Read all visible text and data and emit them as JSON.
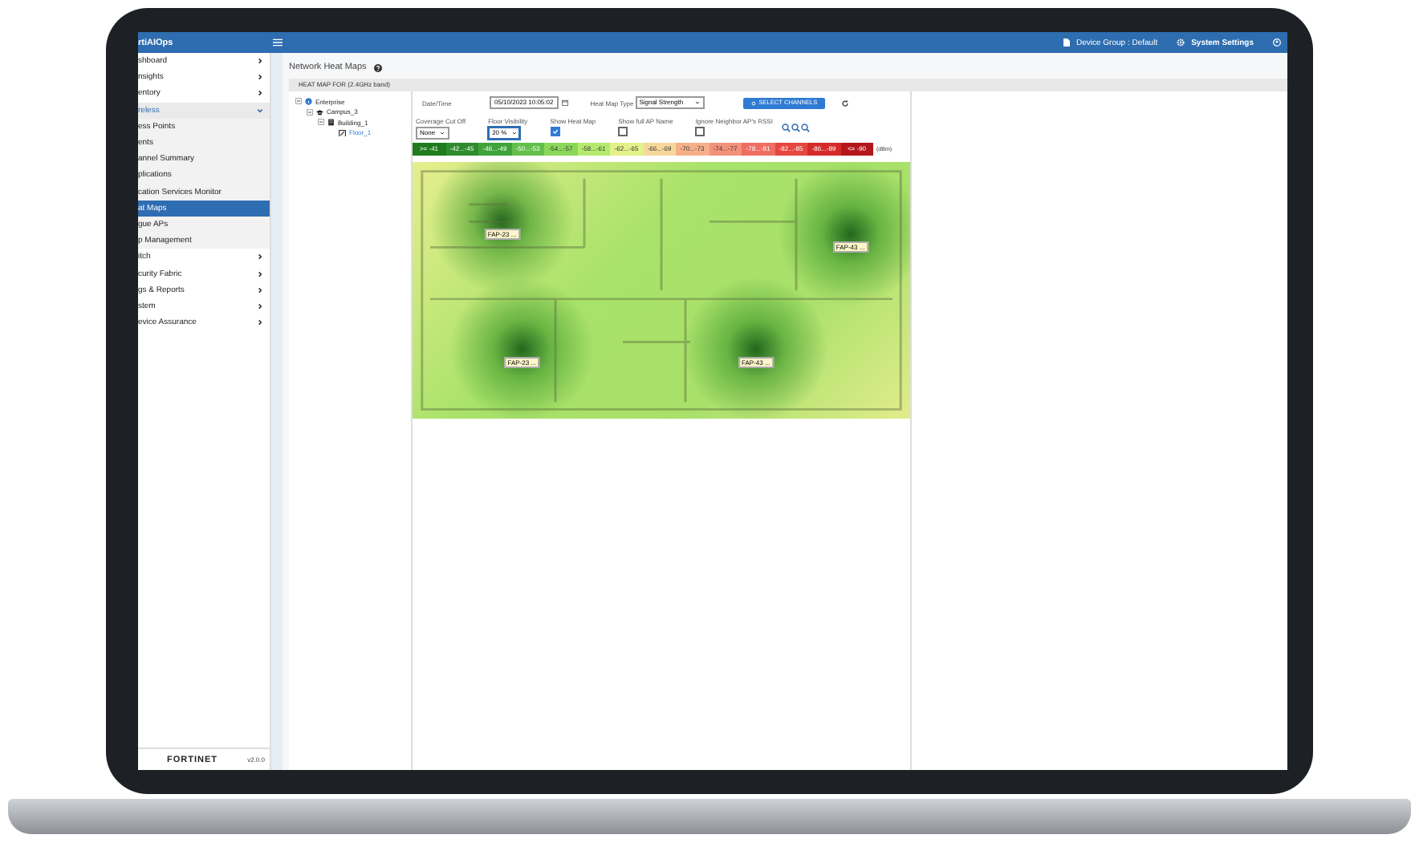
{
  "app": {
    "brand": "rtiAIOps"
  },
  "header": {
    "device_group": "Device Group : Default",
    "settings": "System Settings"
  },
  "sidebar": {
    "items": [
      {
        "label": "shboard",
        "kind": "group",
        "expanded": false,
        "selected": false
      },
      {
        "label": "nsights",
        "kind": "group",
        "expanded": false,
        "selected": false
      },
      {
        "label": "entory",
        "kind": "group",
        "expanded": false,
        "selected": false
      },
      {
        "label": "reless",
        "kind": "group",
        "expanded": true,
        "selected": false
      },
      {
        "label": "ess Points",
        "kind": "sub",
        "selected": false
      },
      {
        "label": "ents",
        "kind": "sub",
        "selected": false
      },
      {
        "label": "annel Summary",
        "kind": "sub",
        "selected": false
      },
      {
        "label": "plications",
        "kind": "sub",
        "selected": false
      },
      {
        "label": "cation Services Monitor",
        "kind": "sub",
        "selected": false
      },
      {
        "label": "at Maps",
        "kind": "sub",
        "selected": true
      },
      {
        "label": "gue APs",
        "kind": "sub",
        "selected": false
      },
      {
        "label": "p Management",
        "kind": "sub",
        "selected": false
      },
      {
        "label": "itch",
        "kind": "group",
        "expanded": false,
        "selected": false
      },
      {
        "label": "curity Fabric",
        "kind": "group",
        "expanded": false,
        "selected": false
      },
      {
        "label": "gs & Reports",
        "kind": "group",
        "expanded": false,
        "selected": false
      },
      {
        "label": "stem",
        "kind": "group",
        "expanded": false,
        "selected": false
      },
      {
        "label": "evice Assurance",
        "kind": "group",
        "expanded": false,
        "selected": false
      }
    ],
    "footer": {
      "logo": "FORTINET",
      "version": "v2.0.0"
    }
  },
  "page": {
    "title": "Network Heat Maps",
    "panel_title": "HEAT MAP FOR (2.4GHz band)"
  },
  "tree": [
    {
      "label": "Enterprise",
      "kind": "site",
      "selected": false,
      "children": [
        {
          "label": "Campus_3",
          "kind": "campus",
          "selected": false,
          "children": [
            {
              "label": "Building_1",
              "kind": "building",
              "selected": false,
              "children": [
                {
                  "label": "Floor_1",
                  "kind": "floor",
                  "selected": true
                }
              ]
            }
          ]
        }
      ]
    }
  ],
  "controls": {
    "datetime_label": "Date/Time",
    "datetime": "05/10/2023 10:05:02",
    "type_label": "Heat Map Type",
    "type": "Signal Strength",
    "select_channels": "SELECT CHANNELS",
    "coverage_label": "Coverage Cut Off",
    "coverage": "None",
    "visibility_label": "Floor Visibility",
    "visibility": "20 %",
    "checks": [
      {
        "label": "Show Heat Map",
        "checked": true
      },
      {
        "label": "Show full AP Name",
        "checked": false
      },
      {
        "label": "Ignore Neighbor AP's RSSI",
        "checked": false
      }
    ]
  },
  "legend": {
    "unit": "(dBm)",
    "items": [
      {
        "label": ">= -41",
        "color": "#1e7b1e"
      },
      {
        "label": "-42...-45",
        "color": "#2e8b2e"
      },
      {
        "label": "-46...-49",
        "color": "#3fa33a"
      },
      {
        "label": "-50...-53",
        "color": "#62c04a"
      },
      {
        "label": "-54...-57",
        "color": "#8ad85a"
      },
      {
        "label": "-58...-61",
        "color": "#b6ea6e"
      },
      {
        "label": "-62...-65",
        "color": "#e3f28a"
      },
      {
        "label": "-66...-69",
        "color": "#f6d89a"
      },
      {
        "label": "-70...-73",
        "color": "#f5b08a"
      },
      {
        "label": "-74...-77",
        "color": "#f3927a"
      },
      {
        "label": "-78...-81",
        "color": "#ee6e62"
      },
      {
        "label": "-82...-85",
        "color": "#e5473f"
      },
      {
        "label": "-86...-89",
        "color": "#d42a2a"
      },
      {
        "label": "<= -90",
        "color": "#b3171c"
      }
    ]
  },
  "aps": [
    {
      "label": "FAP-23 ..."
    },
    {
      "label": "FAP-43 ..."
    },
    {
      "label": "FAP-23 ..."
    },
    {
      "label": "FAP-43 ..."
    }
  ]
}
